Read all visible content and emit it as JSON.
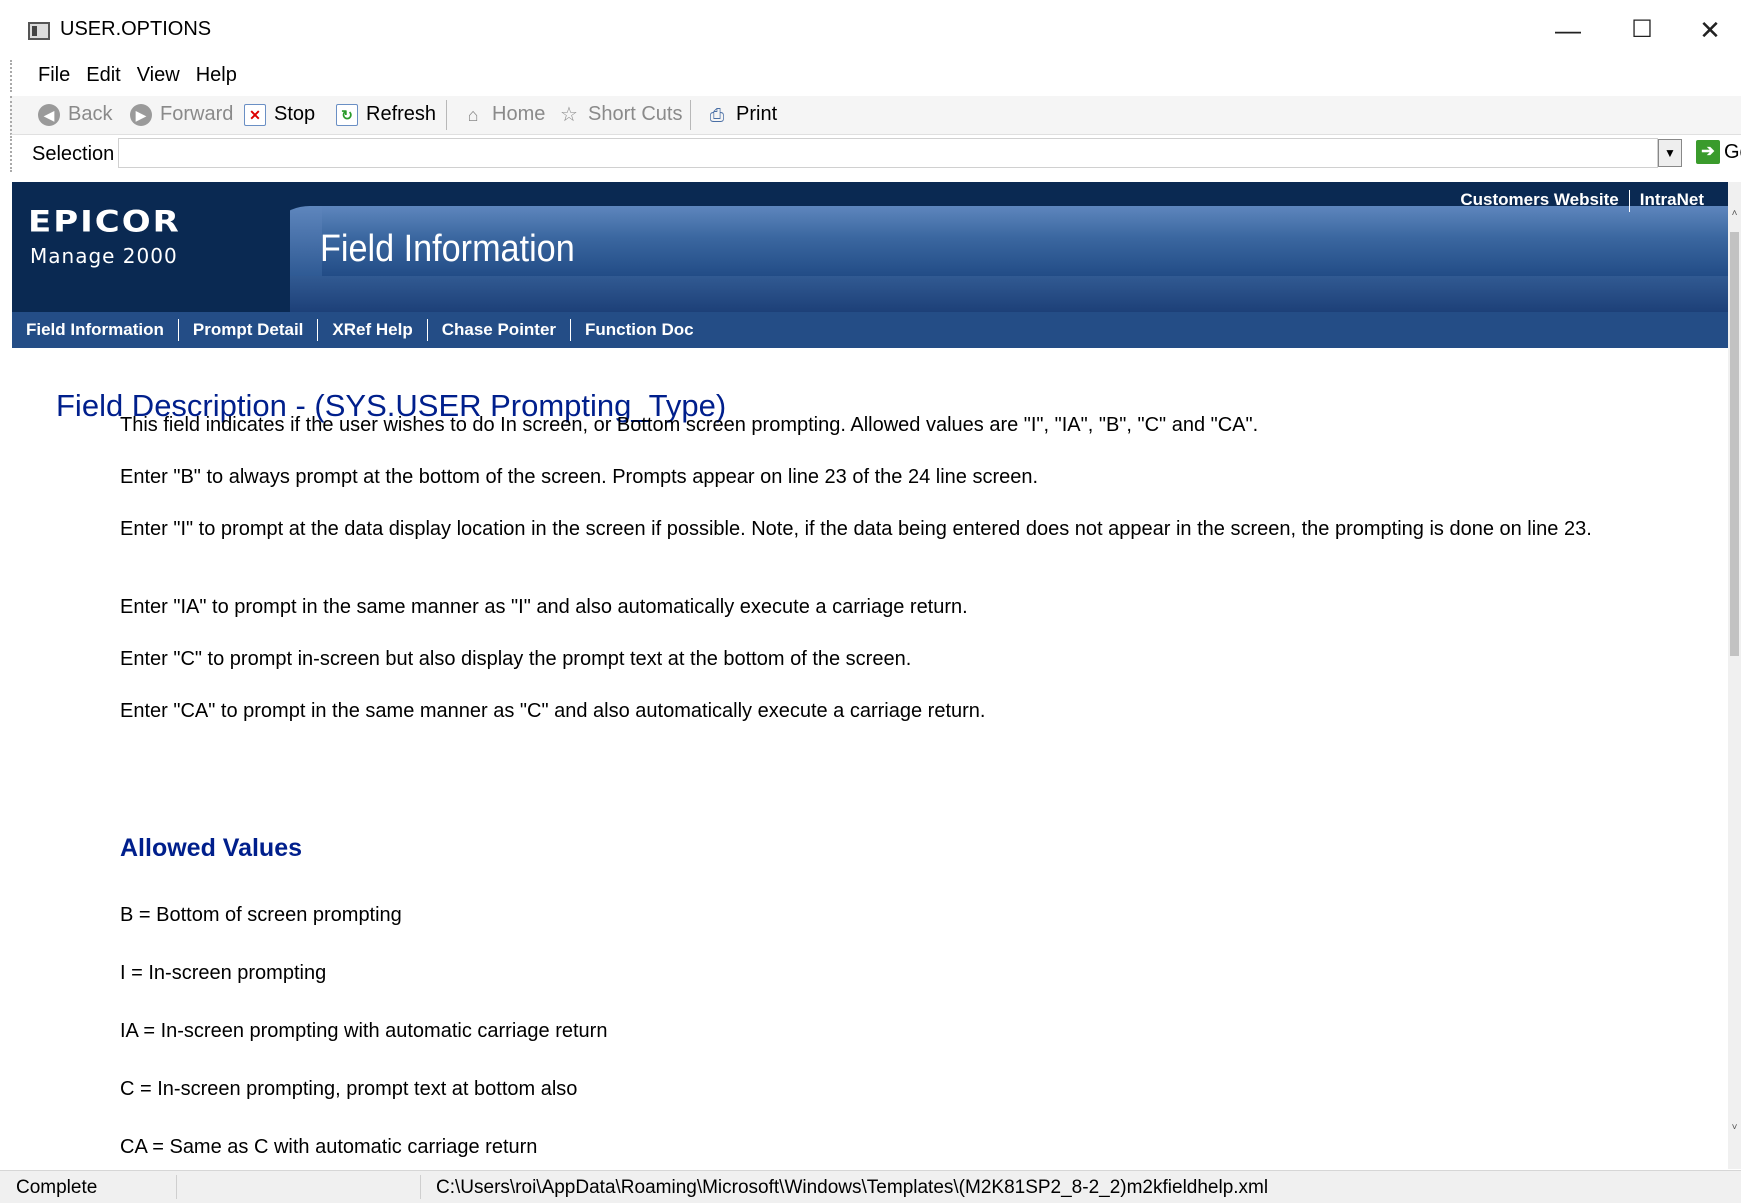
{
  "window": {
    "title": "USER.OPTIONS",
    "minimize": "—",
    "maximize": "☐",
    "close": "✕"
  },
  "menu": {
    "file": "File",
    "edit": "Edit",
    "view": "View",
    "help": "Help"
  },
  "toolbar": {
    "back": "Back",
    "forward": "Forward",
    "stop": "Stop",
    "refresh": "Refresh",
    "home": "Home",
    "shortcuts": "Short Cuts",
    "print": "Print"
  },
  "address": {
    "label": "Selection",
    "value": "",
    "go": "Go"
  },
  "banner": {
    "brand": "EPICOR",
    "brand_sub": "Manage 2000",
    "title": "Field Information",
    "links": [
      "Customers Website",
      "IntraNet"
    ],
    "tabs": [
      "Field Information",
      "Prompt Detail",
      "XRef Help",
      "Chase Pointer",
      "Function Doc"
    ]
  },
  "doc": {
    "heading": "Field Description - (SYS.USER Prompting_Type)",
    "paragraphs": [
      "This field indicates if the user wishes to do In screen, or Bottom screen prompting. Allowed values are \"I\", \"IA\", \"B\", \"C\" and \"CA\".",
      "Enter \"B\" to always prompt at the bottom of the screen. Prompts appear on line 23 of the 24 line screen.",
      "Enter \"I\" to prompt at the data display location in the screen if possible. Note, if the data being entered does not appear in the screen, the prompting is done on line 23.",
      "Enter \"IA\" to prompt in the same manner as \"I\" and also automatically execute a carriage return.",
      "Enter \"C\" to prompt in-screen but also display the prompt text at the bottom of the screen.",
      "Enter \"CA\" to prompt in the same manner as \"C\" and also automatically execute a carriage return."
    ],
    "allowed_heading": "Allowed Values",
    "allowed": [
      "B = Bottom of screen prompting",
      "I = In-screen prompting",
      "IA = In-screen prompting with automatic carriage return",
      "C = In-screen prompting, prompt text at bottom also",
      "CA = Same as C with automatic carriage return"
    ]
  },
  "status": {
    "state": "Complete",
    "path": "C:\\Users\\roi\\AppData\\Roaming\\Microsoft\\Windows\\Templates\\(M2K81SP2_8-2_2)m2kfieldhelp.xml"
  },
  "icons": {
    "back": "back-arrow-icon",
    "forward": "forward-arrow-icon",
    "stop": "stop-icon",
    "refresh": "refresh-icon",
    "home": "home-icon",
    "shortcuts": "star-icon",
    "print": "printer-icon",
    "go": "go-arrow-icon"
  },
  "colors": {
    "heading": "#001f8c",
    "banner": "#0a2952",
    "nav": "#244d86",
    "go": "#3a9b2c"
  }
}
